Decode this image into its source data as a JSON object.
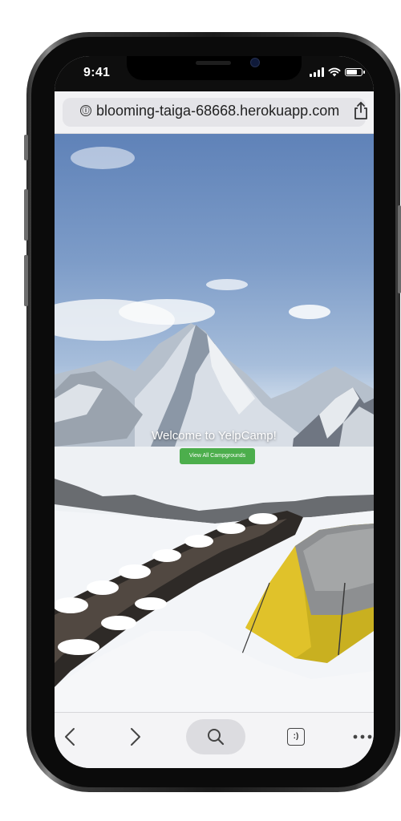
{
  "status_bar": {
    "time": "9:41",
    "icons": [
      "signal-icon",
      "wifi-icon",
      "battery-icon"
    ],
    "battery_level": 0.75
  },
  "browser": {
    "url": "blooming-taiga-68668.herokuapp.com",
    "info_icon": "ⓘ",
    "share_icon": "share-icon"
  },
  "hero": {
    "title": "Welcome to YelpCamp!",
    "button_label": "View All Campgrounds",
    "button_color": "#4cae4c"
  },
  "toolbar": {
    "items": [
      "back-icon",
      "forward-icon",
      "search-icon",
      "tabs-icon",
      "more-icon"
    ],
    "tabs_glyph": ":)"
  },
  "colors": {
    "frame": "#1b1b1b",
    "tent": "#d8b41e",
    "sky": "#6f90c0"
  }
}
